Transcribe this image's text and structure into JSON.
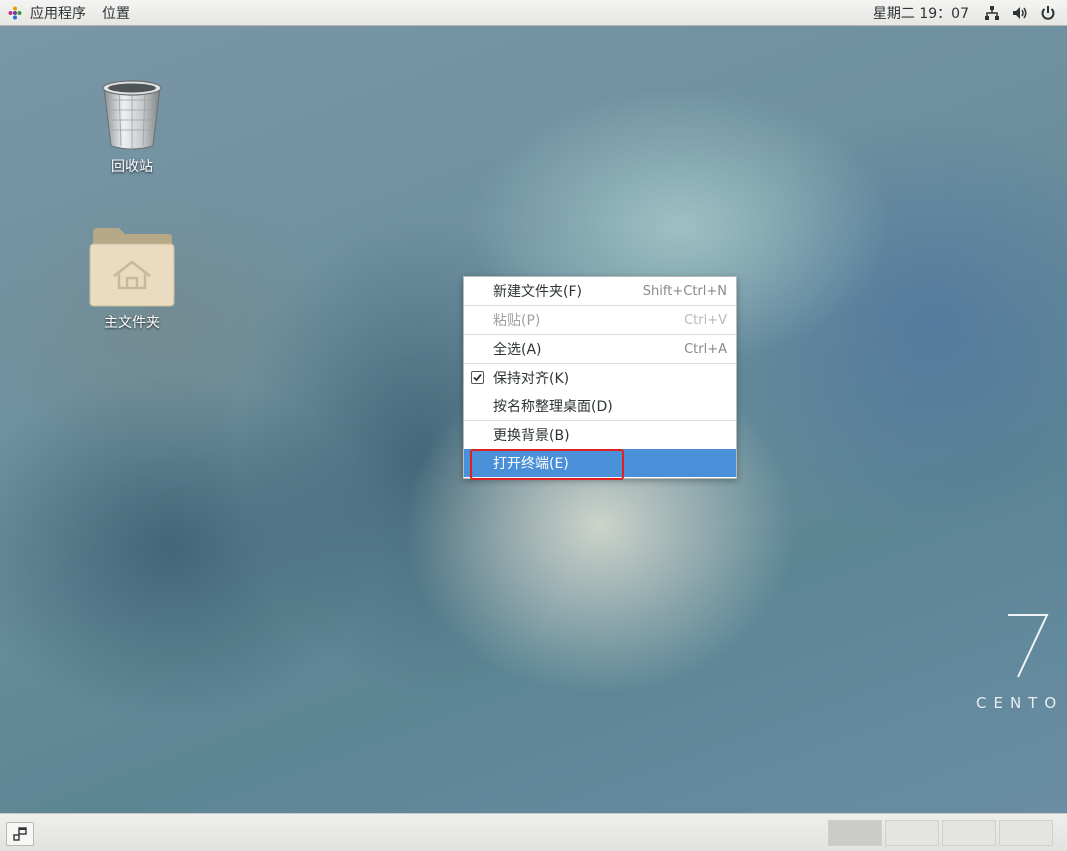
{
  "topbar": {
    "applications_label": "应用程序",
    "places_label": "位置",
    "clock": "星期二 19：07",
    "icons": [
      "network-icon",
      "volume-icon",
      "power-icon"
    ]
  },
  "desktop": {
    "icons": [
      {
        "label": "回收站",
        "icon": "trash-icon"
      },
      {
        "label": "主文件夹",
        "icon": "home-folder-icon"
      }
    ],
    "watermark_number": "7",
    "watermark_text": "CENTO"
  },
  "context_menu": {
    "items": [
      {
        "label": "新建文件夹(F)",
        "accel": "Shift+Ctrl+N",
        "enabled": true
      },
      {
        "label": "粘贴(P)",
        "accel": "Ctrl+V",
        "enabled": false
      },
      {
        "label": "全选(A)",
        "accel": "Ctrl+A",
        "enabled": true
      },
      {
        "label": "保持对齐(K)",
        "accel": "",
        "enabled": true,
        "checked": true
      },
      {
        "label": "按名称整理桌面(D)",
        "accel": "",
        "enabled": true
      },
      {
        "label": "更换背景(B)",
        "accel": "",
        "enabled": true
      },
      {
        "label": "打开终端(E)",
        "accel": "",
        "enabled": true,
        "highlighted": true
      }
    ]
  },
  "bottombar": {
    "workspaces": 4,
    "active_workspace": 1
  },
  "colors": {
    "menu_highlight": "#4a90d9",
    "annotation_box": "#e02020"
  }
}
